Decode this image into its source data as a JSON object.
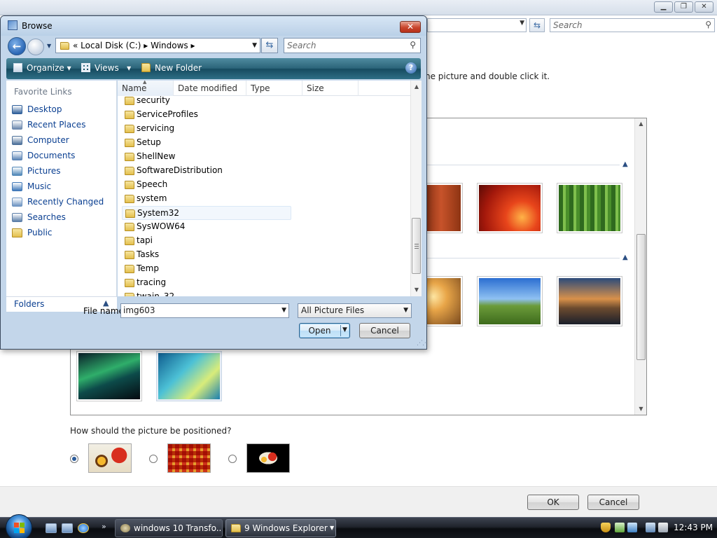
{
  "background_window": {
    "search_placeholder": "Search",
    "instruction": "he picture and double click it.",
    "position_question": "How should the picture be positioned?",
    "ok_label": "OK",
    "cancel_label": "Cancel",
    "caption_min": "▁",
    "caption_max": "❐",
    "caption_close": "✕"
  },
  "dialog": {
    "title": "Browse",
    "address_crumbs": "«  Local Disk (C:)  ▸  Windows  ▸",
    "search_placeholder": "Search",
    "toolbar": {
      "organize": "Organize",
      "views": "Views",
      "new_folder": "New Folder",
      "help": "?"
    },
    "favorite_links_header": "Favorite Links",
    "favorite_links": [
      {
        "label": "Desktop",
        "icon": "desktop-icon",
        "color": "#2f5f9a"
      },
      {
        "label": "Recent Places",
        "icon": "recent-places-icon",
        "color": "#6c88ad"
      },
      {
        "label": "Computer",
        "icon": "computer-icon",
        "color": "#4c6f99"
      },
      {
        "label": "Documents",
        "icon": "documents-icon",
        "color": "#5b84b5"
      },
      {
        "label": "Pictures",
        "icon": "pictures-icon",
        "color": "#4f86b7"
      },
      {
        "label": "Music",
        "icon": "music-icon",
        "color": "#3f78b8"
      },
      {
        "label": "Recently Changed",
        "icon": "recently-changed-icon",
        "color": "#6d94c2"
      },
      {
        "label": "Searches",
        "icon": "searches-icon",
        "color": "#5b7ea8"
      },
      {
        "label": "Public",
        "icon": "public-folder-icon",
        "color": "#e3bf4d"
      }
    ],
    "folders_label": "Folders",
    "columns": [
      "Name",
      "Date modified",
      "Type",
      "Size"
    ],
    "files": [
      "security",
      "ServiceProfiles",
      "servicing",
      "Setup",
      "ShellNew",
      "SoftwareDistribution",
      "Speech",
      "system",
      "System32",
      "SysWOW64",
      "tapi",
      "Tasks",
      "Temp",
      "tracing",
      "twain_32"
    ],
    "hovered_file": "System32",
    "file_name_label": "File name:",
    "file_name_value": "img603",
    "file_type_value": "All Picture Files",
    "open_label": "Open",
    "cancel_label": "Cancel"
  },
  "taskbar": {
    "tasks": [
      {
        "label": "windows 10 Transfo..."
      },
      {
        "label": "9 Windows Explorer",
        "count": "9",
        "name": "Windows Explorer"
      }
    ],
    "clock": "12:43 PM"
  }
}
